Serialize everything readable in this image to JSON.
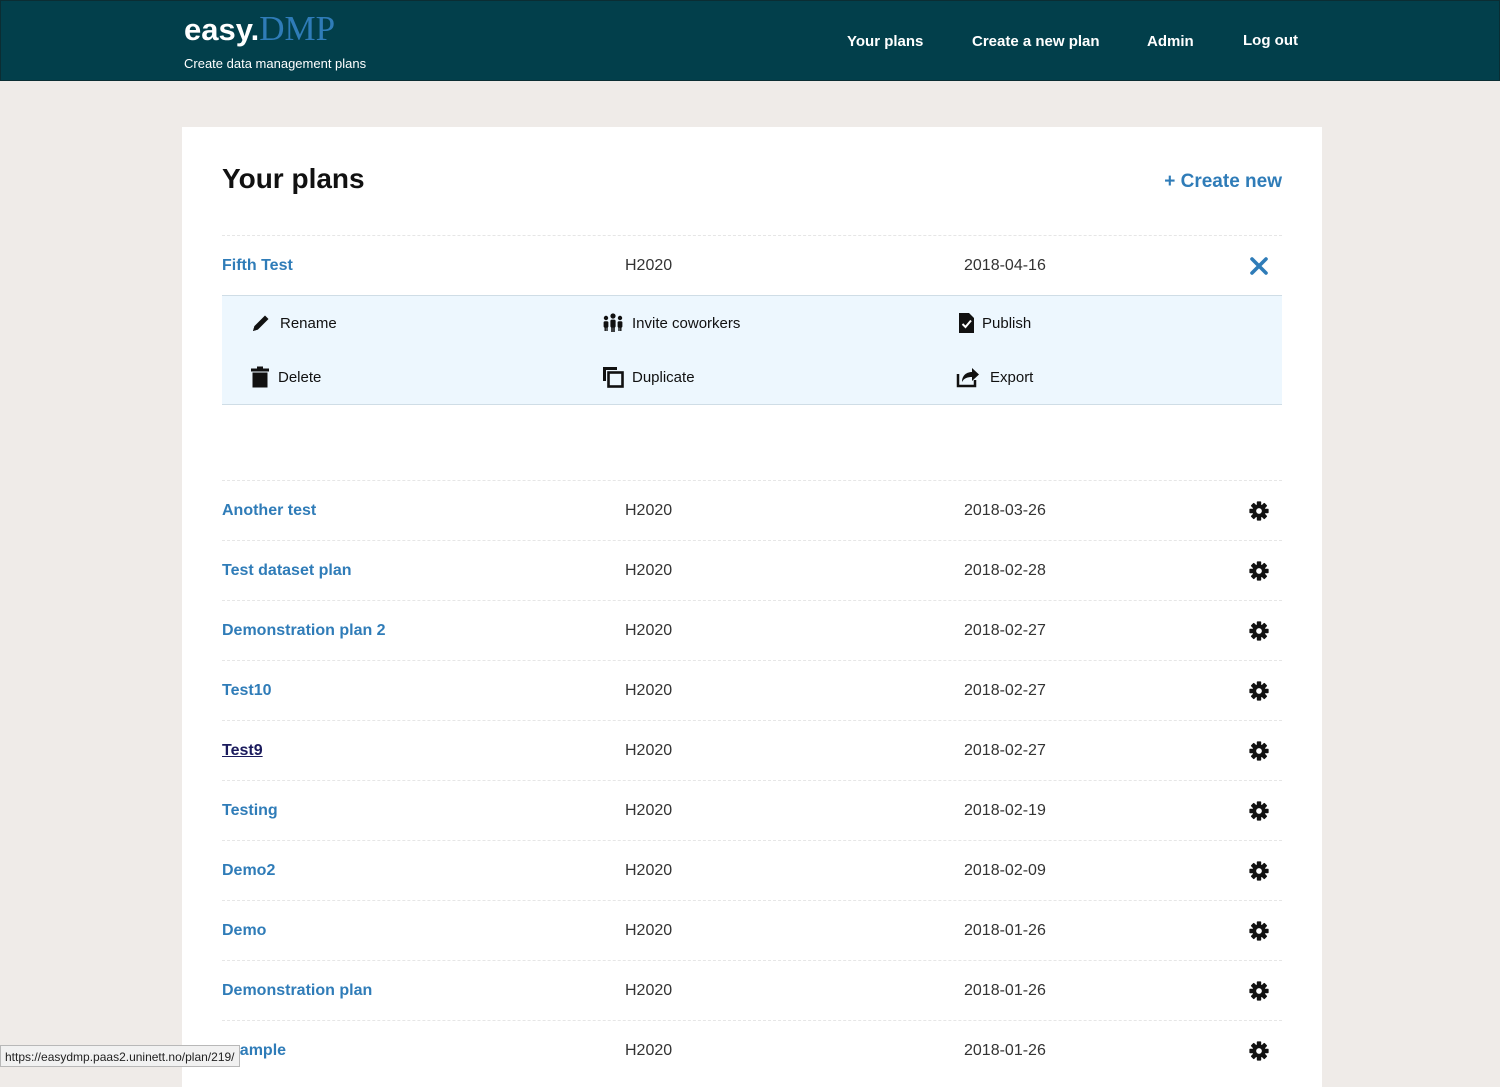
{
  "brand": {
    "name_part1": "easy.",
    "name_part2": "DMP",
    "tagline": "Create data management plans"
  },
  "nav": {
    "items": [
      "Your plans",
      "Create a new plan",
      "Admin",
      "Log out"
    ]
  },
  "page": {
    "title": "Your plans",
    "create_new": "+ Create new"
  },
  "expanded_plan": {
    "title": "Fifth Test",
    "template": "H2020",
    "date": "2018-04-16",
    "close_icon": "close-icon"
  },
  "actions": {
    "rename": "Rename",
    "invite": "Invite coworkers",
    "publish": "Publish",
    "delete": "Delete",
    "duplicate": "Duplicate",
    "export": "Export"
  },
  "plans": [
    {
      "title": "Another test",
      "template": "H2020",
      "date": "2018-03-26"
    },
    {
      "title": "Test dataset plan",
      "template": "H2020",
      "date": "2018-02-28"
    },
    {
      "title": "Demonstration plan 2",
      "template": "H2020",
      "date": "2018-02-27"
    },
    {
      "title": "Test10",
      "template": "H2020",
      "date": "2018-02-27"
    },
    {
      "title": "Test9",
      "template": "H2020",
      "date": "2018-02-27",
      "visited": true
    },
    {
      "title": "Testing",
      "template": "H2020",
      "date": "2018-02-19"
    },
    {
      "title": "Demo2",
      "template": "H2020",
      "date": "2018-02-09"
    },
    {
      "title": "Demo",
      "template": "H2020",
      "date": "2018-01-26"
    },
    {
      "title": "Demonstration plan",
      "template": "H2020",
      "date": "2018-01-26"
    },
    {
      "title": "example",
      "template": "H2020",
      "date": "2018-01-26"
    }
  ],
  "status_bar": {
    "url": "https://easydmp.paas2.uninett.no/plan/219/"
  },
  "colors": {
    "header": "#023f4b",
    "link": "#2f7cb8",
    "visited": "#1a1a5c",
    "action_bg": "#edf7fe"
  }
}
